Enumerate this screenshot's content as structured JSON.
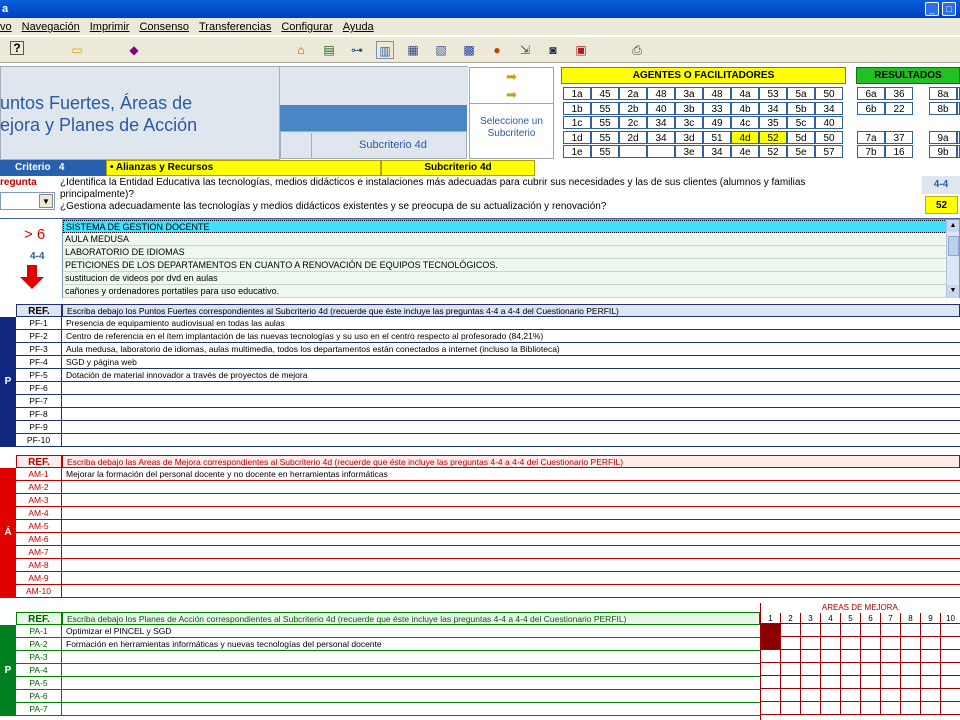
{
  "window": {
    "title": "a"
  },
  "menu": [
    "vo",
    "Navegación",
    "Imprimir",
    "Consenso",
    "Transferencias",
    "Configurar",
    "Ayuda"
  ],
  "header": {
    "title_line1": "untos Fuertes, Áreas de",
    "title_line2": "ejora y Planes de Acción",
    "subcriterio_label": "Subcriterio 4d",
    "select_label_1": "Seleccione un",
    "select_label_2": "Subcriterio"
  },
  "agentes": {
    "title": "AGENTES O FACILITADORES",
    "rows": [
      [
        "1a",
        "45",
        "2a",
        "48",
        "3a",
        "48",
        "4a",
        "53",
        "5a",
        "50"
      ],
      [
        "1b",
        "55",
        "2b",
        "40",
        "3b",
        "33",
        "4b",
        "34",
        "5b",
        "34"
      ],
      [
        "1c",
        "55",
        "2c",
        "34",
        "3c",
        "49",
        "4c",
        "35",
        "5c",
        "40"
      ],
      [
        "1d",
        "55",
        "2d",
        "34",
        "3d",
        "51",
        "4d",
        "52",
        "5d",
        "50"
      ],
      [
        "1e",
        "55",
        "",
        "",
        "3e",
        "34",
        "4e",
        "52",
        "5e",
        "57"
      ]
    ],
    "highlight_color": "#ffff00"
  },
  "resultados": {
    "title": "RESULTADOS",
    "rows": [
      [
        "6a",
        "36",
        "8a",
        ""
      ],
      [
        "6b",
        "22",
        "8b",
        ""
      ],
      [
        "",
        "",
        "",
        ""
      ],
      [
        "7a",
        "37",
        "9a",
        ""
      ],
      [
        "7b",
        "16",
        "9b",
        ""
      ]
    ]
  },
  "criterio": {
    "label": "Criterio",
    "number": "4",
    "name": "• Alianzas y Recursos",
    "sub": "Subcriterio 4d"
  },
  "pregunta": {
    "label": "regunta",
    "q1": "¿Identifica la Entidad Educativa las tecnologías, medios didácticos e instalaciones más adecuadas para cubrir sus necesidades y las de sus clientes (alumnos y familias",
    "q1b": "principalmente)?",
    "q2": "¿Gestiona adecuadamente las tecnologías y medios didácticos existentes y se preocupa de su actualización y renovación?",
    "range": "4-4",
    "score": "52"
  },
  "indicator": {
    "gt": "> 6",
    "range": "4-4"
  },
  "list_items": [
    "SISTEMA DE GESTION DOCENTE",
    "AULA MEDUSA",
    "LABORATORIO DE IDIOMAS",
    "PETICIONES DE LOS DEPARTAMENTOS EN CUANTO A RENOVACIÓN DE EQUIPOS TECNOLÓGICOS.",
    "sustitucion de videos por dvd en aulas",
    "cañones y ordenadores portatiles para uso educativo."
  ],
  "pf": {
    "ref": "REF.",
    "header": "Escriba debajo los Puntos Fuertes correspondientes al Subcriterio 4d (recuerde que éste incluye las preguntas 4-4 a 4-4 del Cuestionario PERFIL)",
    "rows": [
      {
        "id": "PF-1",
        "text": "Presencia de equipamiento audiovisual en todas las aulas"
      },
      {
        "id": "PF-2",
        "text": "Centro de referencia en el ítem implantación de las nuevas tecnologías y su uso en el centro respecto al profesorado (84,21%)"
      },
      {
        "id": "PF-3",
        "text": "Aula medusa, laboratorio de idiomas, aulas multimedia, todos los departamentos están conectados a internet (incluso la Biblioteca)"
      },
      {
        "id": "PF-4",
        "text": "SGD y página web"
      },
      {
        "id": "PF-5",
        "text": "Dotación de material innovador a través de proyectos de mejora"
      },
      {
        "id": "PF-6",
        "text": ""
      },
      {
        "id": "PF-7",
        "text": ""
      },
      {
        "id": "PF-8",
        "text": ""
      },
      {
        "id": "PF-9",
        "text": ""
      },
      {
        "id": "PF-10",
        "text": ""
      }
    ],
    "side": "P"
  },
  "am": {
    "ref": "REF.",
    "header": "Escriba debajo las Areas de Mejora correspondientes al Subcriterio 4d (recuerde que éste incluye las preguntas 4-4 a 4-4 del Cuestionario PERFIL)",
    "rows": [
      {
        "id": "AM-1",
        "text": "Mejorar la formación del personal docente y no docente en herramientas informáticas"
      },
      {
        "id": "AM-2",
        "text": ""
      },
      {
        "id": "AM-3",
        "text": ""
      },
      {
        "id": "AM-4",
        "text": ""
      },
      {
        "id": "AM-5",
        "text": ""
      },
      {
        "id": "AM-6",
        "text": ""
      },
      {
        "id": "AM-7",
        "text": ""
      },
      {
        "id": "AM-8",
        "text": ""
      },
      {
        "id": "AM-9",
        "text": ""
      },
      {
        "id": "AM-10",
        "text": ""
      }
    ],
    "side": "Á"
  },
  "pa": {
    "ref": "REF.",
    "header": "Escriba debajo los Planes de Acción correspondientes al Subcriterio 4d (recuerde que éste incluye las preguntas 4-4 a 4-4 del Cuestionario PERFIL)",
    "areas_title": "AREAS DE MEJORA.",
    "areas_cols": [
      "1",
      "2",
      "3",
      "4",
      "5",
      "6",
      "7",
      "8",
      "9",
      "10"
    ],
    "rows": [
      {
        "id": "PA-1",
        "text": "Optimizar el PINCEL y SGD"
      },
      {
        "id": "PA-2",
        "text": "Formación en herramientas informáticas y nuevas tecnologías del personal docente"
      },
      {
        "id": "PA-3",
        "text": ""
      },
      {
        "id": "PA-4",
        "text": ""
      },
      {
        "id": "PA-5",
        "text": ""
      },
      {
        "id": "PA-6",
        "text": ""
      },
      {
        "id": "PA-7",
        "text": ""
      }
    ],
    "side": "P"
  }
}
